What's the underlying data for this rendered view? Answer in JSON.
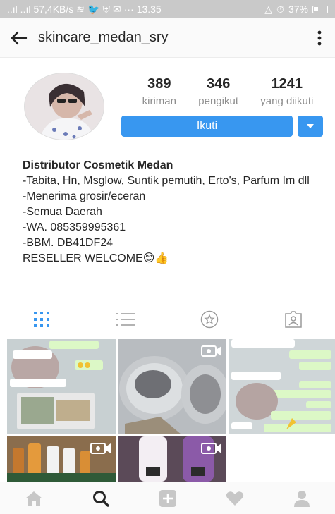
{
  "status_bar": {
    "signal_text": "..ıl ..ıl",
    "speed": "57,4KB/s",
    "time": "13.35",
    "battery": "37%"
  },
  "header": {
    "username": "skincare_medan_sry",
    "back_icon": "arrow-left",
    "menu_icon": "more-vertical"
  },
  "profile": {
    "stats": [
      {
        "value": "389",
        "label": "kiriman"
      },
      {
        "value": "346",
        "label": "pengikut"
      },
      {
        "value": "1241",
        "label": "yang diikuti"
      }
    ],
    "follow_label": "Ikuti"
  },
  "bio": {
    "name": "Distributor Cosmetik Medan",
    "lines": [
      "-Tabita, Hn, Msglow, Suntik pemutih, Erto's, Parfum Im dll",
      "-Menerima grosir/eceran",
      "-Semua Daerah",
      "-WA. 085359995361",
      "-BBM. DB41DF24",
      "RESELLER WELCOME😊👍"
    ]
  },
  "tabs": [
    "grid-icon",
    "list-icon",
    "tagged-star-icon",
    "photos-of-you-icon"
  ],
  "posts": [
    {
      "type": "chat-screenshot",
      "text": "Udh di krim yah shay",
      "video": false
    },
    {
      "type": "cushion-compact",
      "video": true
    },
    {
      "type": "chat-screenshot",
      "text": "Yg mana nih?",
      "video": false
    },
    {
      "type": "product-bottles",
      "video": true
    },
    {
      "type": "product-bottles",
      "video": true
    }
  ],
  "bottom_nav": [
    "home-icon",
    "search-icon",
    "add-icon",
    "heart-icon",
    "profile-icon"
  ],
  "colors": {
    "accent": "#3897f0",
    "active_tab": "#3897f0",
    "statusbar": "#c9c9c9"
  }
}
